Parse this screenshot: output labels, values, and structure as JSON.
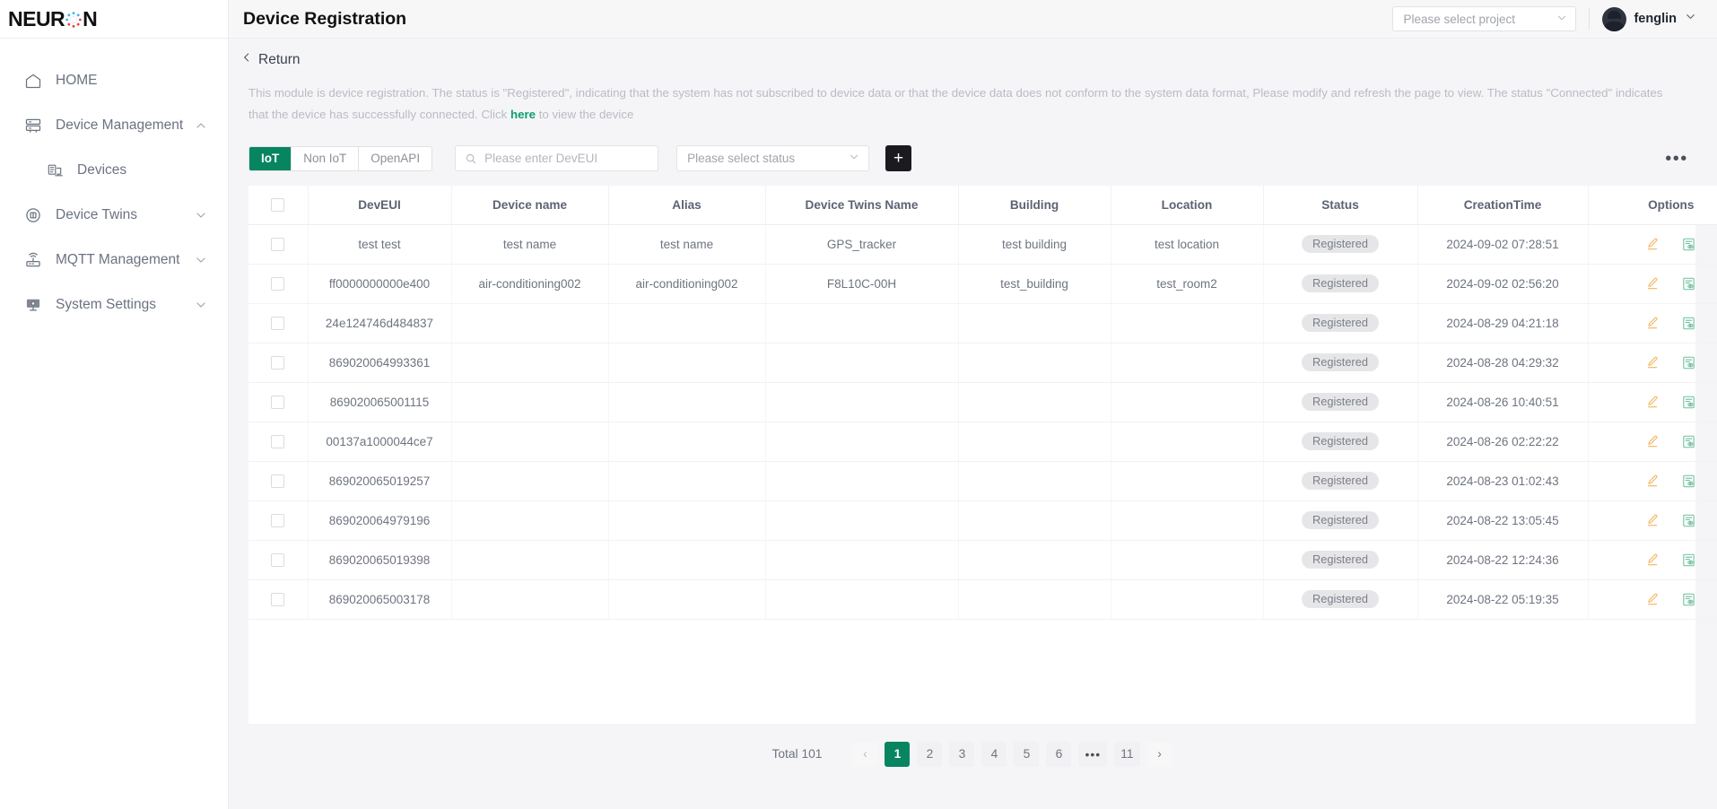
{
  "brand": {
    "name_left": "NEUR",
    "name_right": "N",
    "logo_icon": "neuron-atom-icon"
  },
  "sidebar": {
    "items": [
      {
        "label": "HOME",
        "icon": "home-icon",
        "expandable": false,
        "level": 0
      },
      {
        "label": "Device Management",
        "icon": "server-icon",
        "expandable": true,
        "expanded": true,
        "level": 0
      },
      {
        "label": "Devices",
        "icon": "device-icon",
        "expandable": false,
        "level": 1
      },
      {
        "label": "Device Twins",
        "icon": "twins-icon",
        "expandable": true,
        "expanded": false,
        "level": 0
      },
      {
        "label": "MQTT Management",
        "icon": "router-icon",
        "expandable": true,
        "expanded": false,
        "level": 0
      },
      {
        "label": "System Settings",
        "icon": "monitor-icon",
        "expandable": true,
        "expanded": false,
        "level": 0
      }
    ]
  },
  "header": {
    "title": "Device Registration",
    "project_select": {
      "placeholder": "Please select project",
      "value": ""
    },
    "user": {
      "name": "fenglin"
    }
  },
  "page": {
    "return_label": "Return",
    "description_part1": "This module is device registration. The status is \"Registered\", indicating that the system has not subscribed to device data or that the device data does not conform to the system data format, Please modify and refresh the page to view. The status \"Connected\" indicates that the device has successfully connected. Click ",
    "description_link": "here",
    "description_part2": " to view the device"
  },
  "toolbar": {
    "tabs": [
      {
        "label": "IoT",
        "active": true
      },
      {
        "label": "Non IoT",
        "active": false
      },
      {
        "label": "OpenAPI",
        "active": false
      }
    ],
    "search_placeholder": "Please enter DevEUI",
    "search_value": "",
    "status_placeholder": "Please select status",
    "status_value": "",
    "add_label": "+",
    "more_label": "•••"
  },
  "table": {
    "columns": [
      "DevEUI",
      "Device name",
      "Alias",
      "Device Twins Name",
      "Building",
      "Location",
      "Status",
      "CreationTime",
      "Options"
    ],
    "rows": [
      {
        "deveui": "test test",
        "device_name": "test name",
        "alias": "test name",
        "twins_name": "GPS_tracker",
        "building": "test building",
        "location": "test location",
        "status": "Registered",
        "created": "2024-09-02 07:28:51"
      },
      {
        "deveui": "ff0000000000e400",
        "device_name": "air-conditioning002",
        "alias": "air-conditioning002",
        "twins_name": "F8L10C-00H",
        "building": "test_building",
        "location": "test_room2",
        "status": "Registered",
        "created": "2024-09-02 02:56:20"
      },
      {
        "deveui": "24e124746d484837",
        "device_name": "",
        "alias": "",
        "twins_name": "",
        "building": "",
        "location": "",
        "status": "Registered",
        "created": "2024-08-29 04:21:18"
      },
      {
        "deveui": "869020064993361",
        "device_name": "",
        "alias": "",
        "twins_name": "",
        "building": "",
        "location": "",
        "status": "Registered",
        "created": "2024-08-28 04:29:32"
      },
      {
        "deveui": "869020065001115",
        "device_name": "",
        "alias": "",
        "twins_name": "",
        "building": "",
        "location": "",
        "status": "Registered",
        "created": "2024-08-26 10:40:51"
      },
      {
        "deveui": "00137a1000044ce7",
        "device_name": "",
        "alias": "",
        "twins_name": "",
        "building": "",
        "location": "",
        "status": "Registered",
        "created": "2024-08-26 02:22:22"
      },
      {
        "deveui": "869020065019257",
        "device_name": "",
        "alias": "",
        "twins_name": "",
        "building": "",
        "location": "",
        "status": "Registered",
        "created": "2024-08-23 01:02:43"
      },
      {
        "deveui": "869020064979196",
        "device_name": "",
        "alias": "",
        "twins_name": "",
        "building": "",
        "location": "",
        "status": "Registered",
        "created": "2024-08-22 13:05:45"
      },
      {
        "deveui": "869020065019398",
        "device_name": "",
        "alias": "",
        "twins_name": "",
        "building": "",
        "location": "",
        "status": "Registered",
        "created": "2024-08-22 12:24:36"
      },
      {
        "deveui": "869020065003178",
        "device_name": "",
        "alias": "",
        "twins_name": "",
        "building": "",
        "location": "",
        "status": "Registered",
        "created": "2024-08-22 05:19:35"
      }
    ],
    "row_icons": {
      "edit": "pencil-edit-icon",
      "view": "document-view-icon"
    }
  },
  "pagination": {
    "total_label": "Total 101",
    "prev": "‹",
    "next": "›",
    "pages": [
      "1",
      "2",
      "3",
      "4",
      "5",
      "6",
      "•••",
      "11"
    ],
    "current": "1"
  },
  "colors": {
    "accent_green": "#068560",
    "link_green": "#0f9d6b",
    "edit_icon": "#f2b45a",
    "view_icon": "#6cbf9b",
    "badge_bg": "#e6e6e8",
    "dark_button": "#1b1b1f"
  }
}
